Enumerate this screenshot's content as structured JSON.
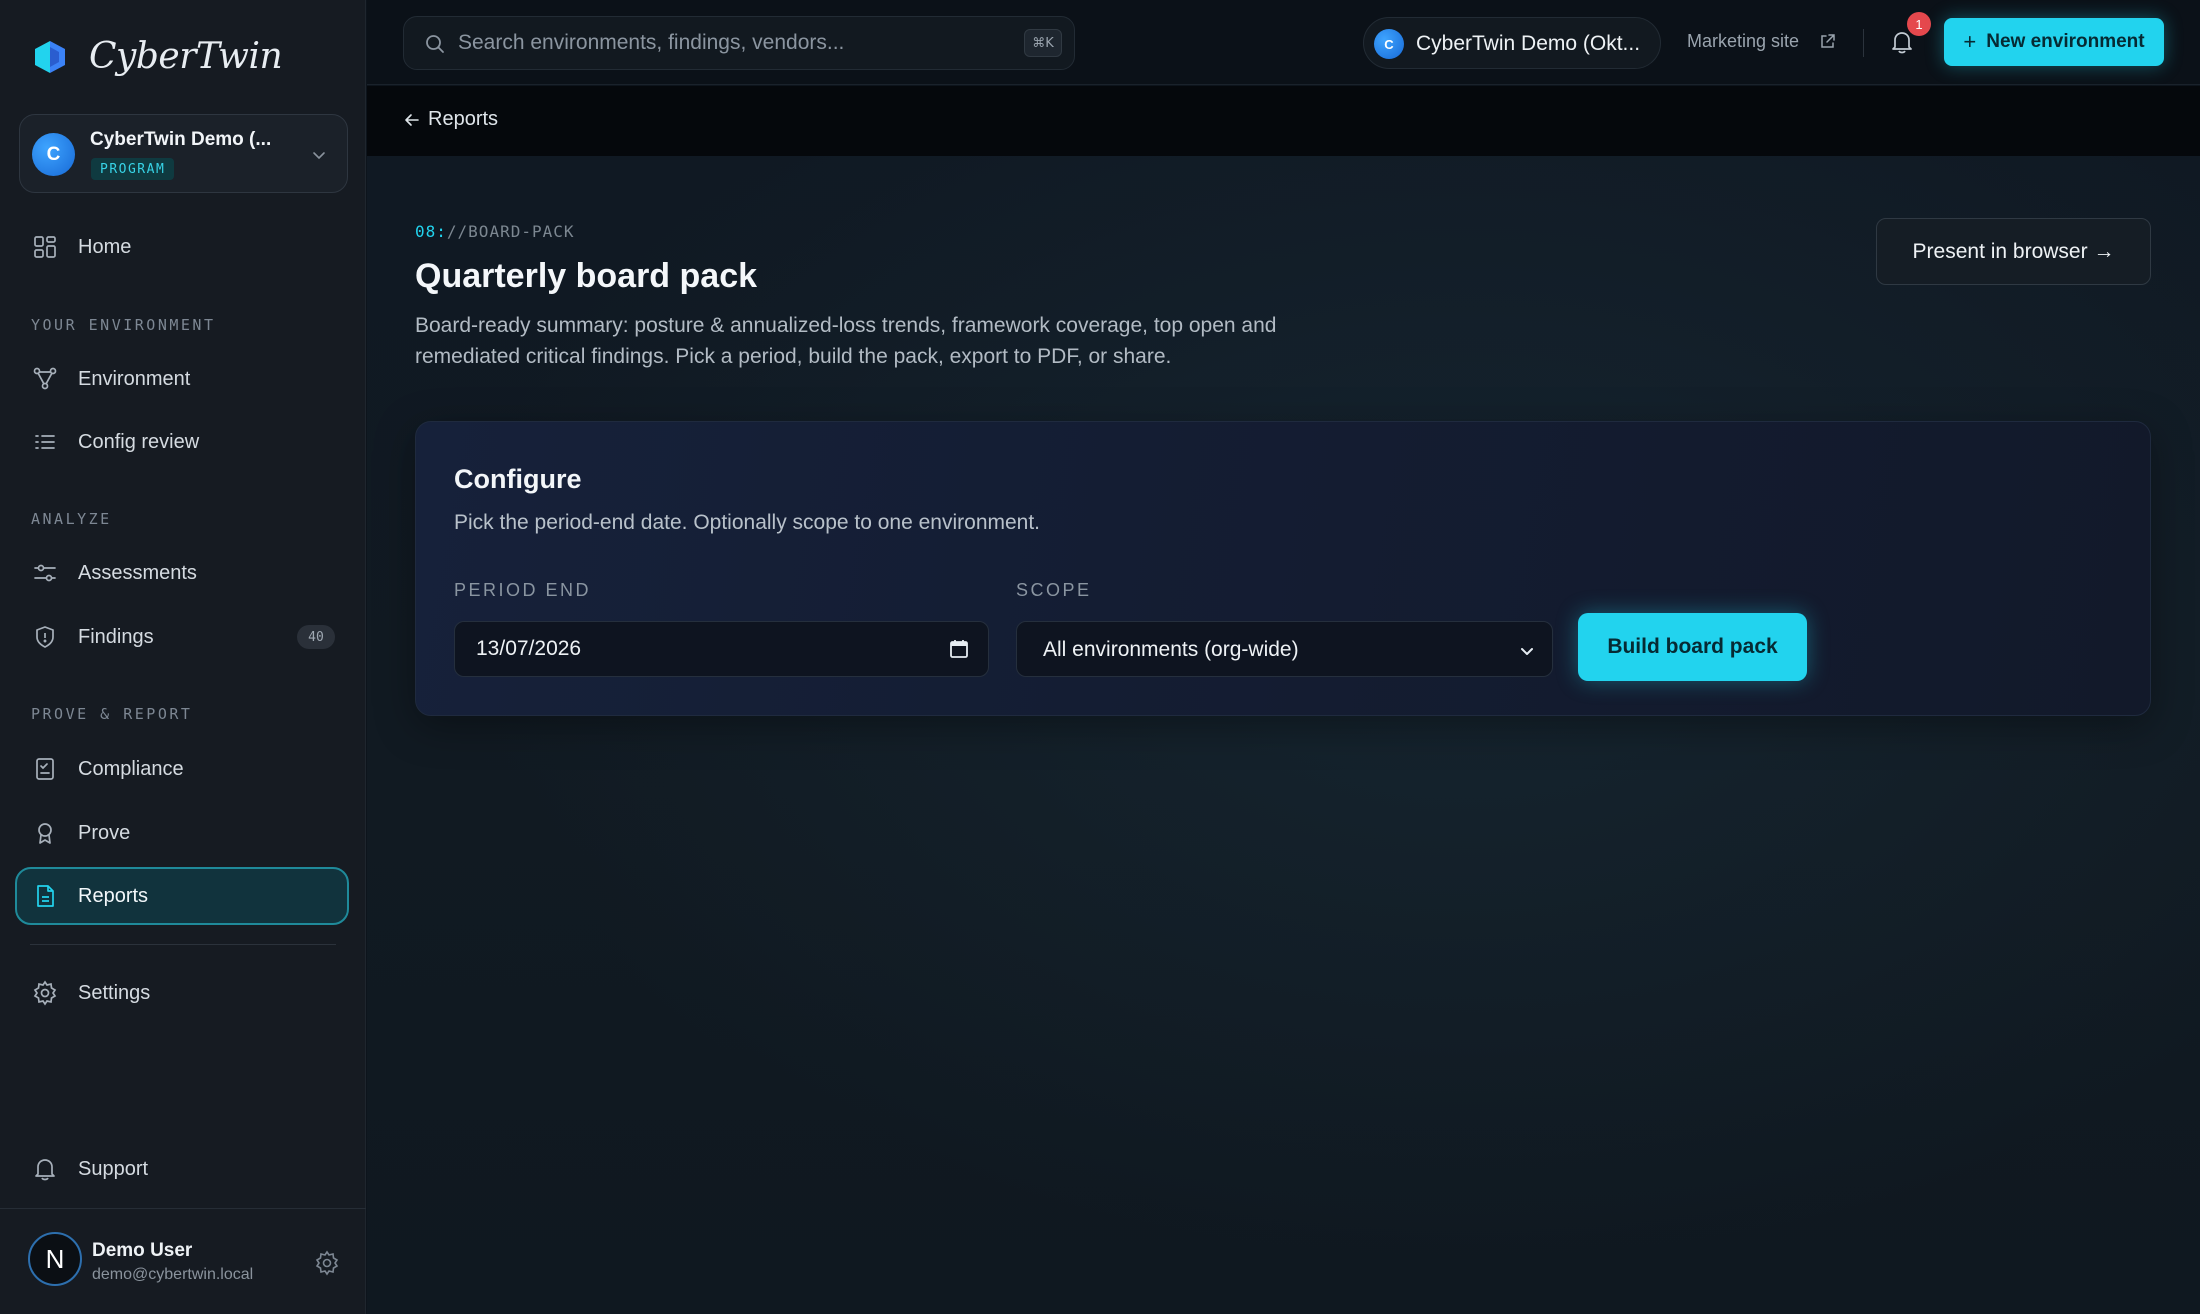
{
  "brand": {
    "name": "CyberTwin"
  },
  "org_switcher": {
    "avatar_letter": "C",
    "name": "CyberTwin Demo (...",
    "badge": "PROGRAM"
  },
  "sidebar": {
    "home": "Home",
    "sections": {
      "environment": "YOUR ENVIRONMENT",
      "analyze": "ANALYZE",
      "prove_report": "PROVE & REPORT"
    },
    "items": {
      "environment": "Environment",
      "config_review": "Config review",
      "assessments": "Assessments",
      "findings": "Findings",
      "findings_count": "40",
      "compliance": "Compliance",
      "prove": "Prove",
      "reports": "Reports",
      "settings": "Settings",
      "support": "Support"
    },
    "active_item": "Reports"
  },
  "user": {
    "avatar_letter": "N",
    "name": "Demo User",
    "email": "demo@cybertwin.local"
  },
  "topbar": {
    "search_placeholder": "Search environments, findings, vendors...",
    "search_shortcut": "⌘K",
    "env_avatar_letter": "C",
    "env_name": "CyberTwin Demo (Okt...",
    "marketing_link": "Marketing site",
    "notification_count": "1",
    "new_env_label": "New environment"
  },
  "breadcrumb": {
    "back_label": "Reports"
  },
  "page": {
    "eyebrow_num": "08:",
    "eyebrow_path": "//BOARD-PACK",
    "title": "Quarterly board pack",
    "description": "Board-ready summary: posture & annualized-loss trends, framework coverage, top open and remediated critical findings. Pick a period, build the pack, export to PDF, or share.",
    "present_label": "Present in browser →"
  },
  "configure": {
    "title": "Configure",
    "description": "Pick the period-end date. Optionally scope to one environment.",
    "period_label": "PERIOD END",
    "period_value": "13/07/2026",
    "scope_label": "SCOPE",
    "scope_value": "All environments (org-wide)",
    "build_label": "Build board pack"
  },
  "colors": {
    "accent": "#22d3ee",
    "badge_red": "#e5484d",
    "brand_blue": "#1769d6"
  }
}
